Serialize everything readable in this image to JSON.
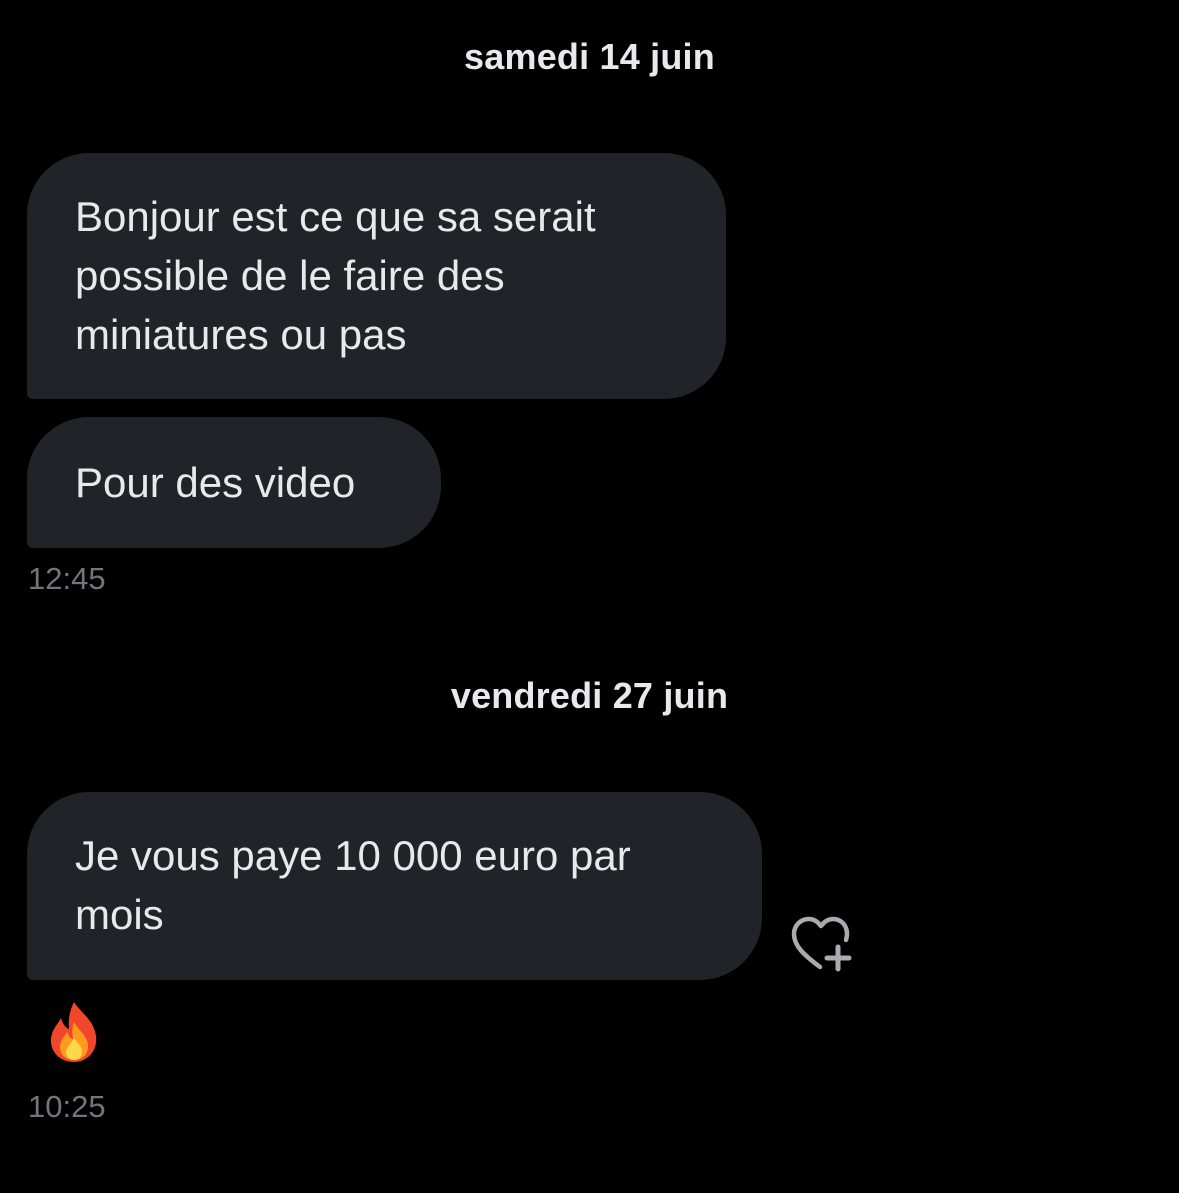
{
  "conversation": {
    "sections": [
      {
        "date": "samedi 14 juin",
        "messages": [
          {
            "lines": [
              "Bonjour est ce que sa serait",
              "possible de le faire des",
              "miniatures ou pas"
            ]
          },
          {
            "lines": [
              "Pour des video"
            ]
          }
        ],
        "time": "12:45"
      },
      {
        "date": "vendredi 27 juin",
        "messages": [
          {
            "lines": [
              "Je vous paye 10 000 euro par",
              "mois"
            ],
            "reaction_emoji": "fire-emoji"
          }
        ],
        "time": "10:25"
      }
    ]
  },
  "icons": {
    "add_reaction": "heart-plus-icon",
    "reaction": "fire-emoji"
  },
  "colors": {
    "background": "#000000",
    "bubble": "#202327",
    "text": "#e7e9ea",
    "timestamp": "#71767b"
  }
}
